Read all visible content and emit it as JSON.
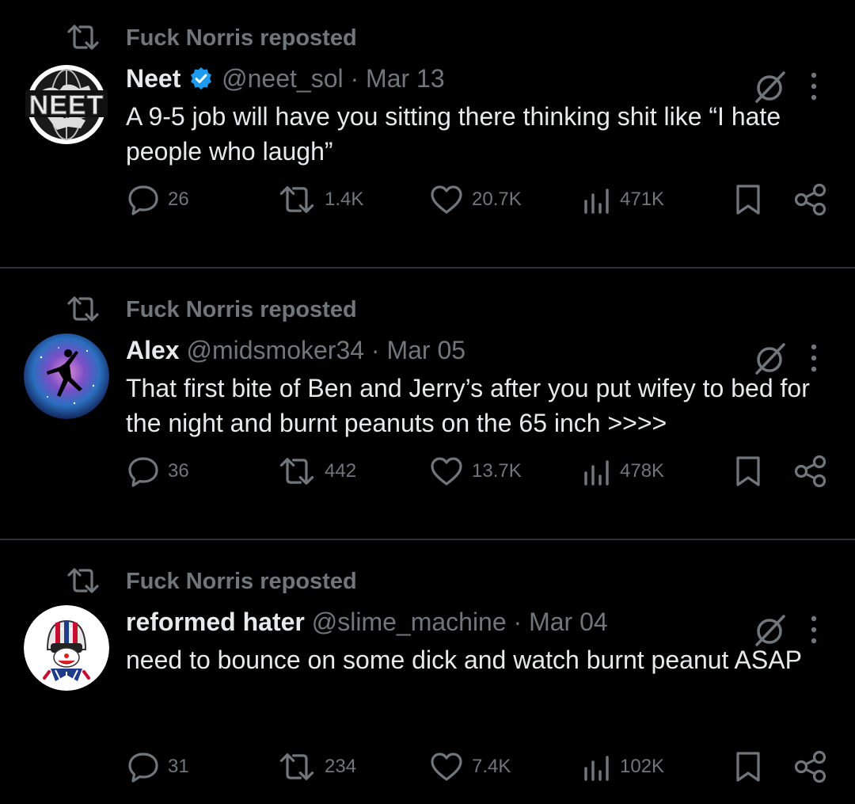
{
  "tweets": [
    {
      "reposted_by": "Fuck Norris reposted",
      "name": "Neet",
      "verified": true,
      "handle": "@neet_sol",
      "separator": "·",
      "date": "Mar 13",
      "text": "A 9-5 job will have you sitting there thinking shit like “I hate people who laugh”",
      "replies": "26",
      "reposts": "1.4K",
      "likes": "20.7K",
      "views": "471K",
      "avatar_icon": "neet-globe-logo"
    },
    {
      "reposted_by": "Fuck Norris reposted",
      "name": "Alex",
      "verified": false,
      "handle": "@midsmoker34",
      "separator": "·",
      "date": "Mar 05",
      "text": "That first bite of Ben and Jerry’s after you put wifey to bed for the night and burnt peanuts on the 65 inch >>>>",
      "replies": "36",
      "reposts": "442",
      "likes": "13.7K",
      "views": "478K",
      "avatar_icon": "galaxy-jumpman"
    },
    {
      "reposted_by": "Fuck Norris reposted",
      "name": "reformed hater",
      "verified": false,
      "handle": "@slime_machine",
      "separator": "·",
      "date": "Mar 04",
      "text": "need to bounce on some dick and watch burnt peanut ASAP",
      "replies": "31",
      "reposts": "234",
      "likes": "7.4K",
      "views": "102K",
      "avatar_icon": "clown-helmet"
    }
  ],
  "colors": {
    "background": "#000000",
    "text": "#e7e9ea",
    "muted": "#71767b",
    "divider": "#2f3336",
    "verified": "#1d9bf0"
  }
}
